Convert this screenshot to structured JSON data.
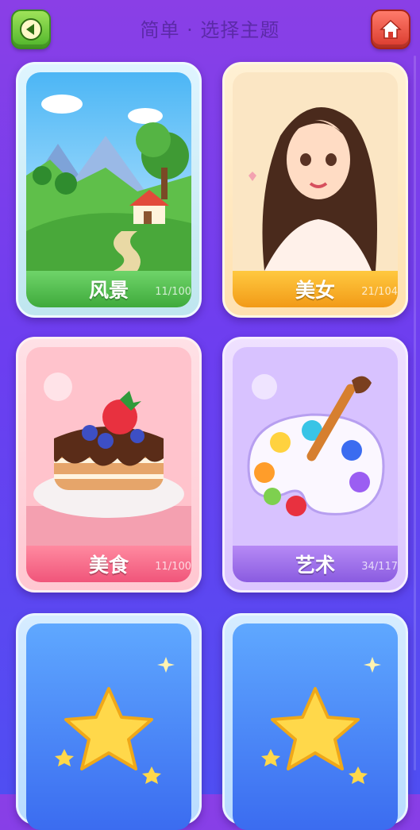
{
  "header": {
    "title": "简单 · 选择主题",
    "back_icon": "back-arrow-icon",
    "home_icon": "home-icon"
  },
  "themes": [
    {
      "label": "风景",
      "count": "11/100",
      "progress": 0.11,
      "accent": "#3faa3c"
    },
    {
      "label": "美女",
      "count": "21/104",
      "progress": 0.2,
      "accent": "#f29a17"
    },
    {
      "label": "美食",
      "count": "11/100",
      "progress": 0.11,
      "accent": "#f0557a"
    },
    {
      "label": "艺术",
      "count": "34/117",
      "progress": 0.29,
      "accent": "#8a5be0"
    }
  ],
  "locked": [
    {
      "icon": "star-icon"
    },
    {
      "icon": "star-icon"
    }
  ]
}
